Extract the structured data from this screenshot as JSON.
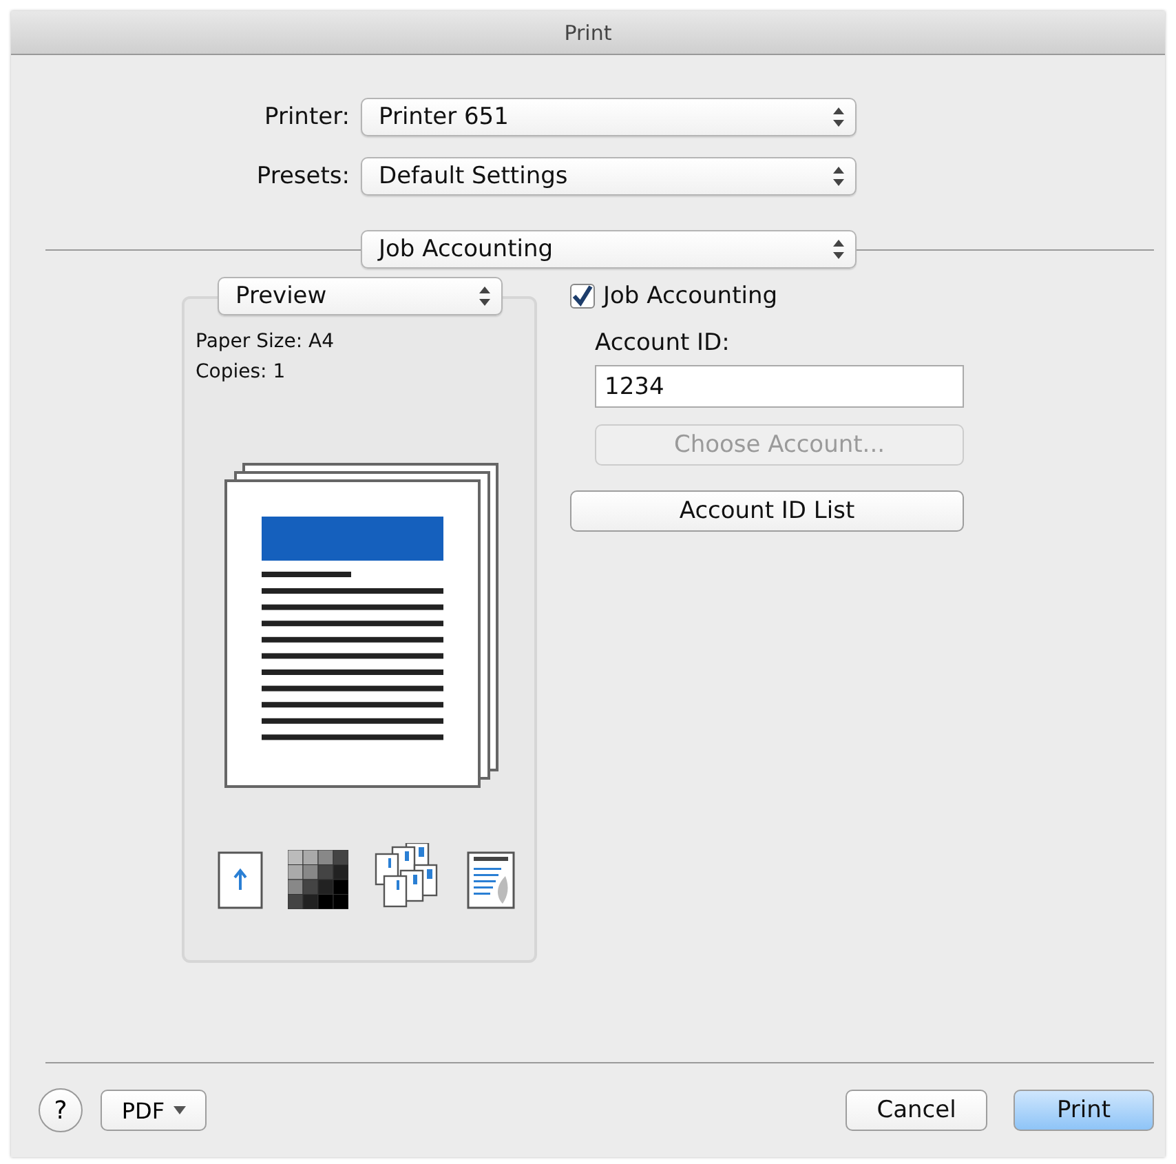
{
  "window": {
    "title": "Print"
  },
  "printer": {
    "label": "Printer:",
    "value": "Printer 651"
  },
  "presets": {
    "label": "Presets:",
    "value": "Default Settings"
  },
  "panel_menu": {
    "value": "Job Accounting"
  },
  "preview": {
    "menu": "Preview",
    "paper_size": "Paper Size: A4",
    "copies": "Copies: 1"
  },
  "job_accounting": {
    "label": "Job Accounting",
    "checked": true
  },
  "account_id": {
    "label": "Account ID:",
    "value": "1234"
  },
  "buttons": [
    {
      "label": "Choose Account...",
      "disabled": true
    },
    {
      "label": "Account ID List",
      "disabled": false
    }
  ],
  "footer": {
    "help": "?",
    "pdf": "PDF",
    "buttons": [
      {
        "label": "Cancel",
        "default": false
      },
      {
        "label": "Print",
        "default": true
      }
    ]
  }
}
